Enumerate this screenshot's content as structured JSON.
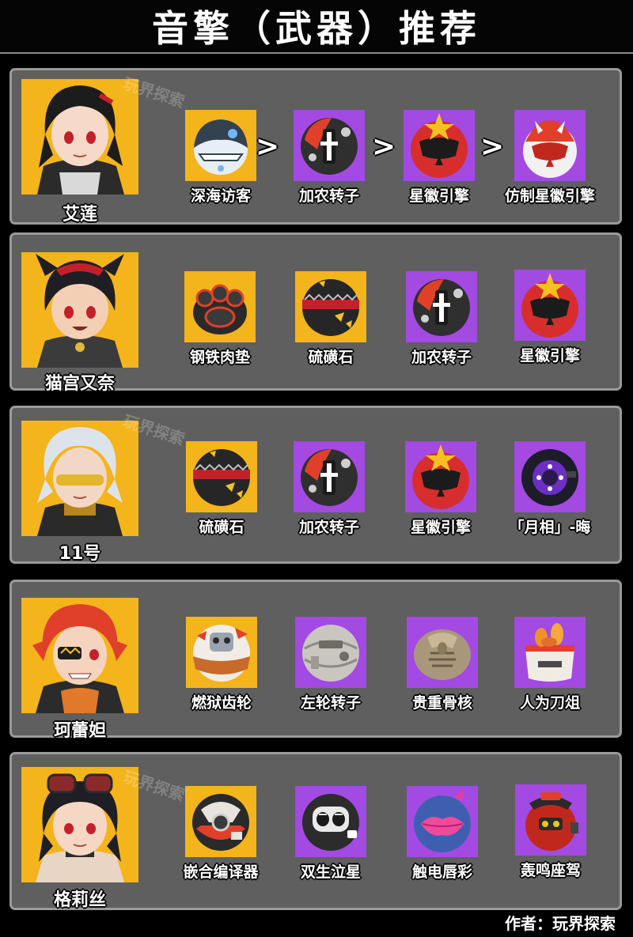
{
  "title": "音擎（武器）推荐",
  "watermark": "玩界探索",
  "author": "作者：玩界探索",
  "arrow_symbol": ">",
  "characters": [
    {
      "name": "艾莲",
      "items": [
        {
          "label": "深海访客",
          "rarity": "gold",
          "icon": "shark-drive-icon"
        },
        {
          "label": "加农转子",
          "rarity": "purple",
          "icon": "cannon-rotor-icon"
        },
        {
          "label": "星徽引擎",
          "rarity": "purple",
          "icon": "starlight-engine-icon"
        },
        {
          "label": "仿制星徽引擎",
          "rarity": "purple",
          "icon": "replica-starlight-engine-icon"
        }
      ]
    },
    {
      "name": "猫宫又奈",
      "items": [
        {
          "label": "钢铁肉垫",
          "rarity": "gold",
          "icon": "steel-cushion-icon"
        },
        {
          "label": "硫磺石",
          "rarity": "gold",
          "icon": "brimstone-icon"
        },
        {
          "label": "加农转子",
          "rarity": "purple",
          "icon": "cannon-rotor-icon"
        },
        {
          "label": "星徽引擎",
          "rarity": "purple",
          "icon": "starlight-engine-icon"
        }
      ]
    },
    {
      "name": "11号",
      "items": [
        {
          "label": "硫磺石",
          "rarity": "gold",
          "icon": "brimstone-icon"
        },
        {
          "label": "加农转子",
          "rarity": "purple",
          "icon": "cannon-rotor-icon"
        },
        {
          "label": "星徽引擎",
          "rarity": "purple",
          "icon": "starlight-engine-icon"
        },
        {
          "label": "「月相」-晦",
          "rarity": "purple",
          "icon": "lunar-noviluna-icon"
        }
      ]
    },
    {
      "name": "珂蕾妲",
      "items": [
        {
          "label": "燃狱齿轮",
          "rarity": "gold",
          "icon": "hellfire-gears-icon"
        },
        {
          "label": "左轮转子",
          "rarity": "purple",
          "icon": "six-shooter-icon"
        },
        {
          "label": "贵重骨核",
          "rarity": "purple",
          "icon": "precious-fossilized-core-icon"
        },
        {
          "label": "人为刀俎",
          "rarity": "purple",
          "icon": "demara-battery-icon"
        }
      ]
    },
    {
      "name": "格莉丝",
      "items": [
        {
          "label": "嵌合编译器",
          "rarity": "gold",
          "icon": "fusion-compiler-icon"
        },
        {
          "label": "双生泣星",
          "rarity": "purple",
          "icon": "weeping-gemini-icon"
        },
        {
          "label": "触电唇彩",
          "rarity": "purple",
          "icon": "electro-lip-gloss-icon"
        },
        {
          "label": "轰鸣座驾",
          "rarity": "purple",
          "icon": "roaring-ride-icon"
        }
      ]
    }
  ],
  "colors": {
    "background": "#000000",
    "panel": "#5f5f5f",
    "panel_border": "#9a9a9a",
    "gold": "#f4b41c",
    "purple": "#a34ae2",
    "text": "#ffffff"
  }
}
